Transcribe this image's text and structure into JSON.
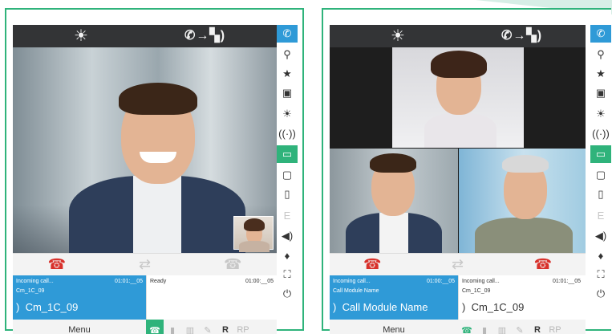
{
  "left_panel": {
    "topbar": {
      "sun_icon": "☀",
      "transfer_icon": "⇢",
      "transfer_text": "✆→▚)"
    },
    "call_status": {
      "active": {
        "status": "Incoming call...",
        "time": "01:01:__05",
        "sub": "Cm_1C_09",
        "name": "Cm_1C_09"
      },
      "idle": {
        "status": "Ready",
        "time": "01:00:__05"
      }
    },
    "menu_label": "Menu",
    "r_label": "R",
    "rp_label": "RP"
  },
  "right_panel": {
    "call_status": {
      "active": {
        "status": "Incoming call...",
        "time": "01:00:__05",
        "sub": "Call Module Name",
        "name": "Call Module Name"
      },
      "second": {
        "status": "Incoming call...",
        "time": "01:01:__05",
        "sub": "Cm_1C_09",
        "name": "Cm_1C_09"
      }
    },
    "menu_label": "Menu",
    "r_label": "R",
    "rp_label": "RP"
  },
  "sidebar_icons": [
    "transfer-icon",
    "location-icon",
    "star-icon",
    "intercom-icon",
    "light-icon",
    "broadcast-icon",
    "camera-icon",
    "screen-icon",
    "door-icon",
    "e-icon",
    "volume-icon",
    "mic-icon",
    "fullscreen-icon",
    "power-icon"
  ],
  "colors": {
    "accent_green": "#2fb37b",
    "accent_blue": "#2f9ad7",
    "hangup_red": "#d8312b",
    "topbar": "#333436"
  }
}
